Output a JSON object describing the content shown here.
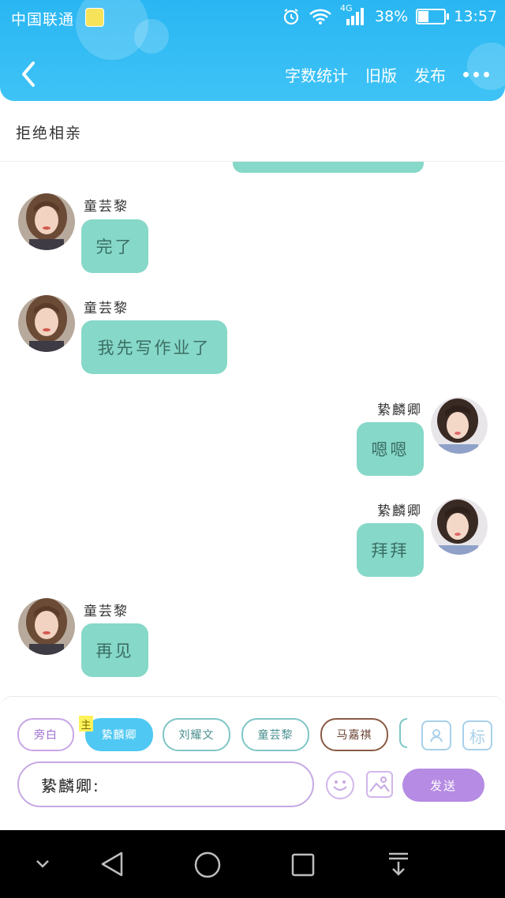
{
  "status_bar": {
    "carrier": "中国联通",
    "network": "4G",
    "battery": "38%",
    "battery_level": 0.38,
    "time": "13:57"
  },
  "header": {
    "actions": [
      "字数统计",
      "旧版",
      "发布"
    ]
  },
  "title": "拒绝相亲",
  "messages": [
    {
      "side": "left",
      "sender": "童芸黎",
      "text": "完了"
    },
    {
      "side": "left",
      "sender": "童芸黎",
      "text": "我先写作业了"
    },
    {
      "side": "right",
      "sender": "絷麟卿",
      "text": "嗯嗯"
    },
    {
      "side": "right",
      "sender": "絷麟卿",
      "text": "拜拜"
    },
    {
      "side": "left",
      "sender": "童芸黎",
      "text": "再见"
    }
  ],
  "composer": {
    "main_tag": "主",
    "chips": [
      {
        "label": "旁白",
        "color": "#c9a6e6",
        "text_color": "#9c6fcf"
      },
      {
        "label": "絷麟卿",
        "color": "#4fc8f3",
        "text_color": "#ffffff",
        "selected": true
      },
      {
        "label": "刘耀文",
        "color": "#7fc6c6",
        "text_color": "#4a8e8e"
      },
      {
        "label": "童芸黎",
        "color": "#7fc6c6",
        "text_color": "#4a8e8e"
      },
      {
        "label": "马嘉祺",
        "color": "#8a5a44",
        "text_color": "#6a4232"
      }
    ],
    "tag_button_label": "标",
    "input_value": "絷麟卿:",
    "send_label": "发送"
  },
  "colors": {
    "header": "#29b6f2",
    "bubble": "#86d8c8",
    "send": "#b58be3"
  },
  "icons": [
    "back-icon",
    "more-icon",
    "contacts-icon",
    "emoji-icon",
    "image-icon",
    "alarm-icon",
    "wifi-icon",
    "signal-icon",
    "battery-icon",
    "nav-down-icon",
    "nav-back-icon",
    "nav-home-icon",
    "nav-recent-icon",
    "nav-notification-icon"
  ]
}
